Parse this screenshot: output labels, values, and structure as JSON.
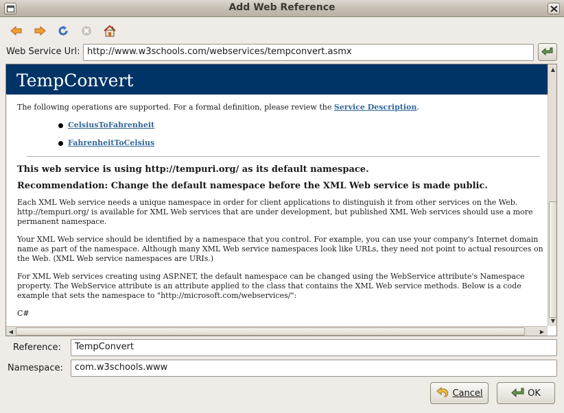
{
  "window": {
    "title": "Add Web Reference"
  },
  "toolbar": {
    "icons": [
      "back-arrow-icon",
      "forward-arrow-icon",
      "refresh-icon",
      "stop-icon",
      "home-icon"
    ]
  },
  "url": {
    "label": "Web Service Url:",
    "value": "http://www.w3schools.com/webservices/tempconvert.asmx"
  },
  "page": {
    "banner": "TempConvert",
    "intro_text": "The following operations are supported. For a formal definition, please review the",
    "intro_link": "Service Description",
    "intro_end": ".",
    "operations": [
      "CelsiusToFahrenheit",
      "FahrenheitToCelsius"
    ],
    "heading1": "This web service is using http://tempuri.org/ as its default namespace.",
    "heading2": "Recommendation: Change the default namespace before the XML Web service is made public.",
    "para1": "Each XML Web service needs a unique namespace in order for client applications to distinguish it from other services on the Web. http://tempuri.org/ is available for XML Web services that are under development, but published XML Web services should use a more permanent namespace.",
    "para2": "Your XML Web service should be identified by a namespace that you control. For example, you can use your company's Internet domain name as part of the namespace. Although many XML Web service namespaces look like URLs, they need not point to actual resources on the Web. (XML Web service namespaces are URIs.)",
    "para3": "For XML Web services creating using ASP.NET, the default namespace can be changed using the WebService attribute's Namespace property. The WebService attribute is an attribute applied to the class that contains the XML Web service methods. Below is a code example that sets the namespace to \"http://microsoft.com/webservices/\":",
    "code_label": "C#"
  },
  "reference": {
    "label": "Reference:",
    "value": "TempConvert"
  },
  "namespace": {
    "label": "Namespace:",
    "value": "com.w3schools.www"
  },
  "buttons": {
    "cancel": "Cancel",
    "ok": "OK"
  }
}
